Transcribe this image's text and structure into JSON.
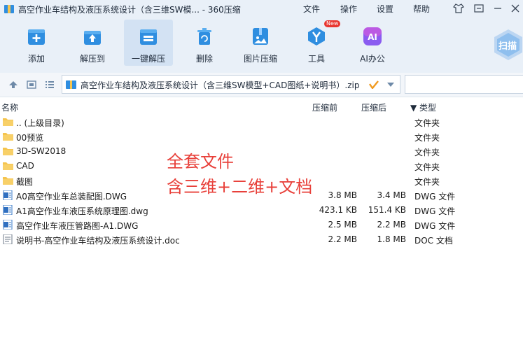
{
  "window": {
    "title": "高空作业车结构及液压系统设计（含三维SW模... - 360压缩"
  },
  "menu": [
    "文件",
    "操作",
    "设置",
    "帮助"
  ],
  "toolbar": [
    {
      "label": "添加",
      "icon": "add-icon"
    },
    {
      "label": "解压到",
      "icon": "extract-to-icon"
    },
    {
      "label": "一键解压",
      "icon": "one-click-extract-icon"
    },
    {
      "label": "删除",
      "icon": "trash-icon"
    },
    {
      "label": "图片压缩",
      "icon": "image-compress-icon"
    },
    {
      "label": "工具",
      "icon": "tools-icon",
      "badge": "New"
    },
    {
      "label": "AI办公",
      "icon": "ai-office-icon",
      "icon_text": "AI"
    }
  ],
  "scan": {
    "label": "扫描"
  },
  "address": {
    "path": "高空作业车结构及液压系统设计（含三维SW模型+CAD图纸+说明书）.zip - 解"
  },
  "columns": {
    "name": "名称",
    "packed": "压缩前",
    "compressed": "压缩后",
    "type": "▼ 类型"
  },
  "files": [
    {
      "name": ".. (上级目录)",
      "size": "",
      "packed": "",
      "type": "文件夹",
      "kind": "folder"
    },
    {
      "name": "00预览",
      "size": "",
      "packed": "",
      "type": "文件夹",
      "kind": "folder"
    },
    {
      "name": "3D-SW2018",
      "size": "",
      "packed": "",
      "type": "文件夹",
      "kind": "folder"
    },
    {
      "name": "CAD",
      "size": "",
      "packed": "",
      "type": "文件夹",
      "kind": "folder"
    },
    {
      "name": "截图",
      "size": "",
      "packed": "",
      "type": "文件夹",
      "kind": "folder"
    },
    {
      "name": "A0高空作业车总装配图.DWG",
      "size": "3.8 MB",
      "packed": "3.4 MB",
      "type": "DWG 文件",
      "kind": "dwg"
    },
    {
      "name": "A1高空作业车液压系统原理图.dwg",
      "size": "423.1 KB",
      "packed": "151.4 KB",
      "type": "DWG 文件",
      "kind": "dwg"
    },
    {
      "name": "高空作业车液压管路图-A1.DWG",
      "size": "2.5 MB",
      "packed": "2.2 MB",
      "type": "DWG 文件",
      "kind": "dwg"
    },
    {
      "name": "说明书-高空作业车结构及液压系统设计.doc",
      "size": "2.2 MB",
      "packed": "1.8 MB",
      "type": "DOC 文档",
      "kind": "doc"
    }
  ],
  "overlay": {
    "line1": "全套文件",
    "line2": "含三维+二维+文档"
  },
  "colors": {
    "accent": "#2f8ee0",
    "folder": "#f5c44e",
    "overlay_text": "#e8403a",
    "toolbar_bg": "#e9f0f8"
  }
}
